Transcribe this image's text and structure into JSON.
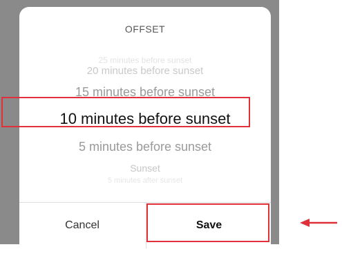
{
  "dialog": {
    "title": "OFFSET",
    "picker_options": [
      "25 minutes before sunset",
      "20 minutes before sunset",
      "15 minutes before sunset",
      "10 minutes before sunset",
      "5 minutes before sunset",
      "Sunset",
      "5 minutes after sunset"
    ],
    "selected_index": 3,
    "cancel_label": "Cancel",
    "save_label": "Save"
  },
  "annotations": {
    "highlight_color": "#e0303a",
    "arrow_icon": "left-arrow-icon"
  }
}
